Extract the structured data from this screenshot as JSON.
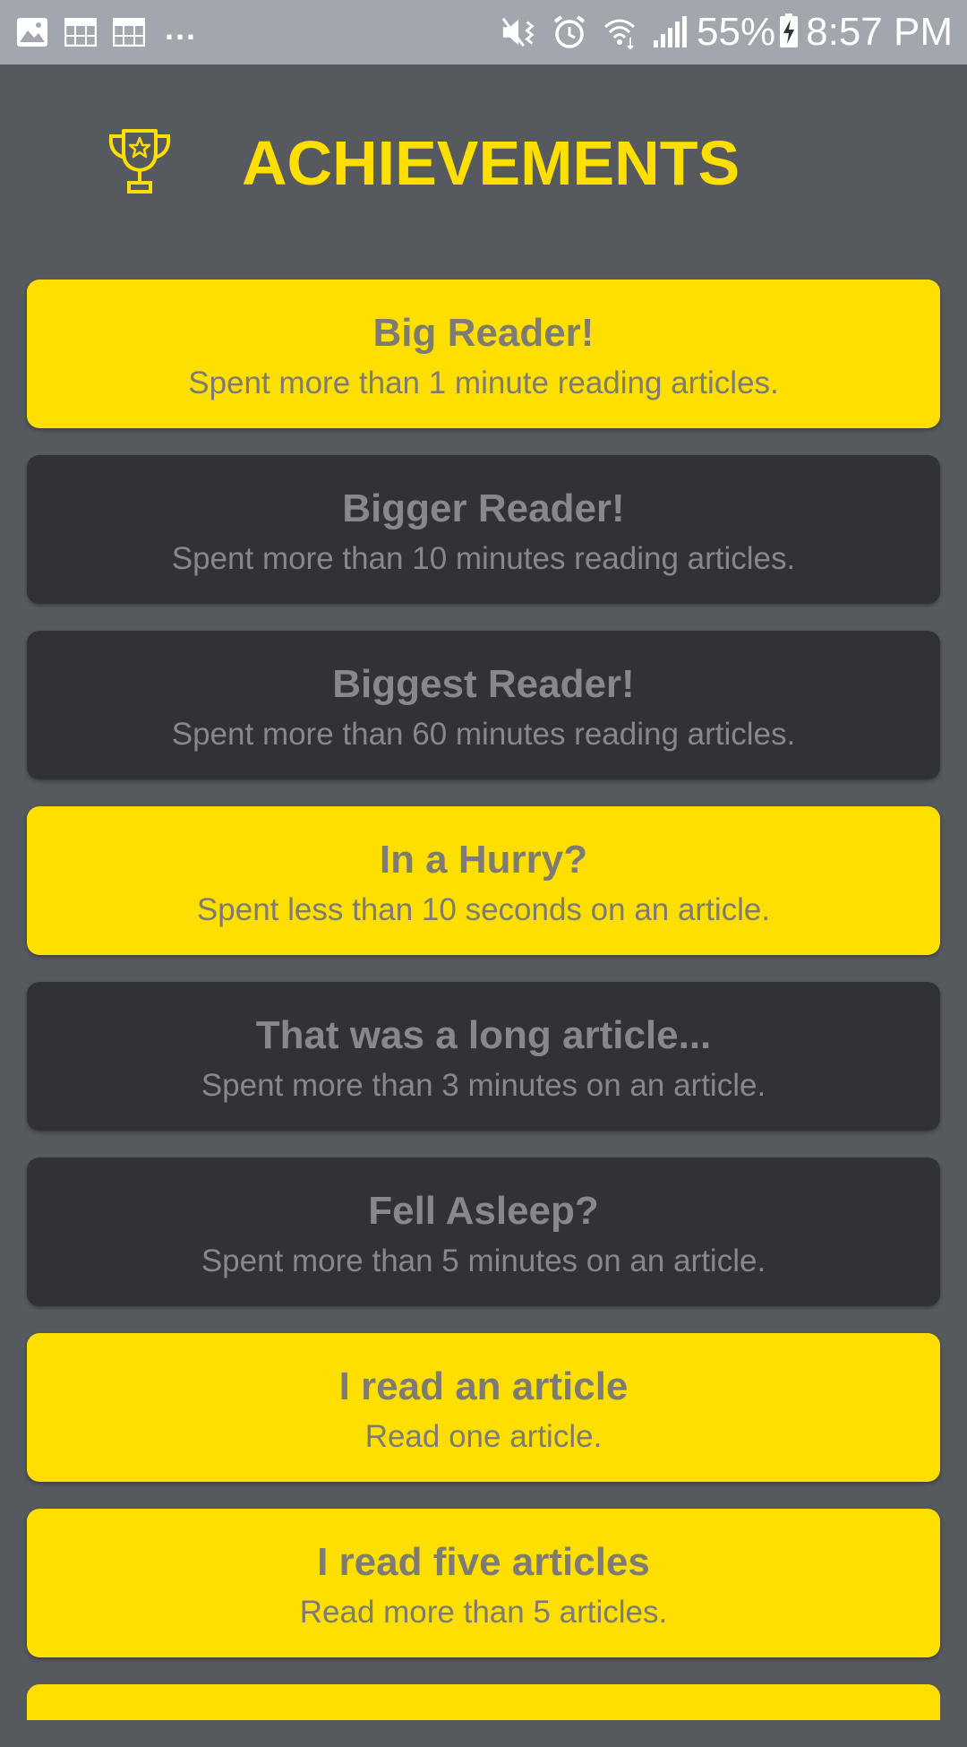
{
  "status_bar": {
    "battery": "55%",
    "time": "8:57 PM",
    "overflow": "..."
  },
  "header": {
    "title": "ACHIEVEMENTS",
    "icon": "trophy-icon"
  },
  "colors": {
    "accent": "#ffdf00",
    "background": "#565a5f",
    "locked_card": "#303236",
    "status_bar": "#a2a7ae"
  },
  "achievements": [
    {
      "title": "Big Reader!",
      "description": "Spent more than 1 minute reading articles.",
      "unlocked": true
    },
    {
      "title": "Bigger Reader!",
      "description": "Spent more than 10 minutes reading articles.",
      "unlocked": false
    },
    {
      "title": "Biggest Reader!",
      "description": "Spent more than 60 minutes reading articles.",
      "unlocked": false
    },
    {
      "title": "In a Hurry?",
      "description": "Spent less than 10 seconds on an article.",
      "unlocked": true
    },
    {
      "title": "That was a long article...",
      "description": "Spent more than 3 minutes on an article.",
      "unlocked": false
    },
    {
      "title": "Fell Asleep?",
      "description": "Spent more than 5 minutes on an article.",
      "unlocked": false
    },
    {
      "title": "I read an article",
      "description": "Read one article.",
      "unlocked": true
    },
    {
      "title": "I read five articles",
      "description": "Read more than 5 articles.",
      "unlocked": true
    }
  ]
}
